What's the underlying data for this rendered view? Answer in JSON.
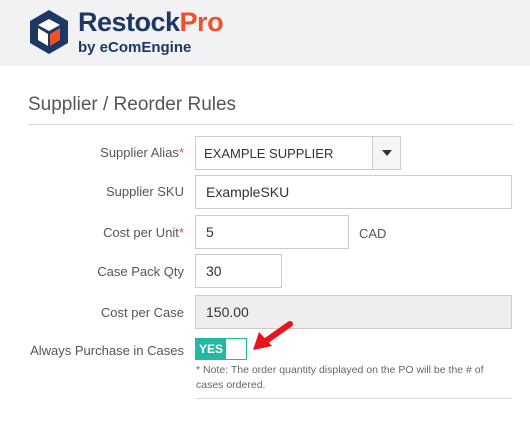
{
  "brand": {
    "name_main": "Restock",
    "name_accent": "Pro",
    "tagline": "by eComEngine",
    "icon": "hexagon-box-icon",
    "colors": {
      "navy": "#1d3865",
      "orange": "#f0502c"
    }
  },
  "form": {
    "title": "Supplier / Reorder Rules",
    "supplier_alias": {
      "label": "Supplier Alias",
      "required": "*",
      "value": "EXAMPLE SUPPLIER"
    },
    "supplier_sku": {
      "label": "Supplier SKU",
      "value": "ExampleSKU"
    },
    "cost_per_unit": {
      "label": "Cost per Unit",
      "required": "*",
      "value": "5",
      "currency": "CAD"
    },
    "case_pack_qty": {
      "label": "Case Pack Qty",
      "value": "30"
    },
    "cost_per_case": {
      "label": "Cost per Case",
      "value": "150.00"
    },
    "always_purchase_in_cases": {
      "label": "Always Purchase in Cases",
      "toggle_label": "YES",
      "on": true,
      "note": "* Note: The order quantity displayed on the PO will be the # of cases ordered."
    }
  },
  "annotation": {
    "icon": "red-arrow-icon",
    "color": "#e8141c"
  },
  "toggle_color": "#23b8a0"
}
